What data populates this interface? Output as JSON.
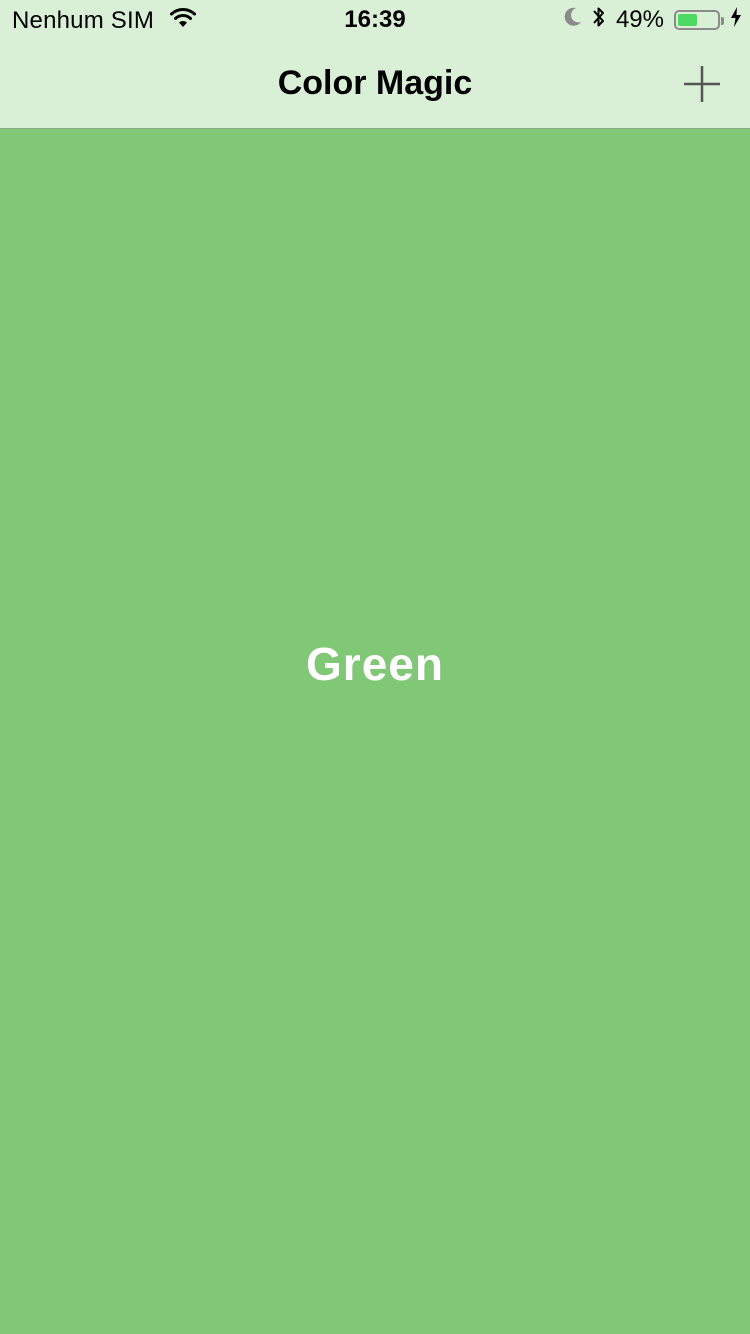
{
  "status_bar": {
    "carrier": "Nenhum SIM",
    "time": "16:39",
    "battery_percent_label": "49%",
    "battery_level": 0.49,
    "icons": [
      "wifi-icon",
      "moon-icon",
      "bluetooth-icon",
      "battery-icon",
      "charging-bolt-icon"
    ]
  },
  "nav": {
    "title": "Color Magic",
    "add_icon": "plus-icon"
  },
  "content": {
    "color_name": "Green"
  },
  "colors": {
    "background": "#80c776",
    "bar_tint": "#d9f0d6",
    "battery_fill": "#4cd964",
    "text_on_color": "#ffffff"
  }
}
